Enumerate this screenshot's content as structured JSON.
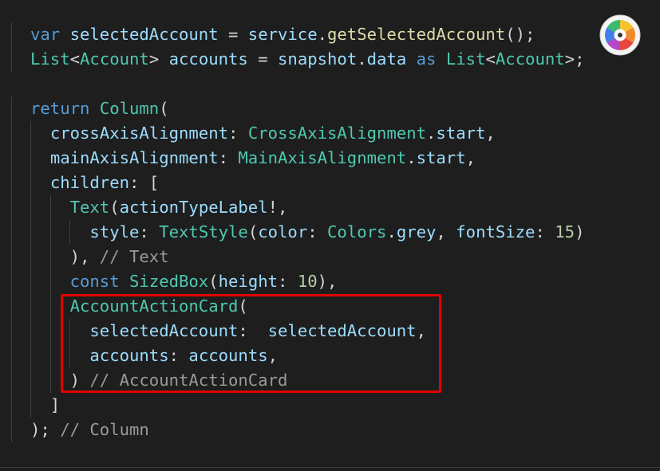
{
  "lines": [
    {
      "tokens": [
        [
          "kw",
          "var"
        ],
        [
          "pl",
          " "
        ],
        [
          "va",
          "selectedAccount"
        ],
        [
          "pl",
          " = "
        ],
        [
          "va",
          "service"
        ],
        [
          "pl",
          "."
        ],
        [
          "fn",
          "getSelectedAccount"
        ],
        [
          "pl",
          "();"
        ]
      ]
    },
    {
      "tokens": [
        [
          "ty",
          "List"
        ],
        [
          "pl",
          "<"
        ],
        [
          "ty",
          "Account"
        ],
        [
          "pl",
          "> "
        ],
        [
          "va",
          "accounts"
        ],
        [
          "pl",
          " = "
        ],
        [
          "va",
          "snapshot"
        ],
        [
          "pl",
          "."
        ],
        [
          "va",
          "data"
        ],
        [
          "pl",
          " "
        ],
        [
          "kw",
          "as"
        ],
        [
          "pl",
          " "
        ],
        [
          "ty",
          "List"
        ],
        [
          "pl",
          "<"
        ],
        [
          "ty",
          "Account"
        ],
        [
          "pl",
          ">;"
        ]
      ]
    },
    {
      "tokens": []
    },
    {
      "tokens": [
        [
          "kw",
          "return"
        ],
        [
          "pl",
          " "
        ],
        [
          "ty",
          "Column"
        ],
        [
          "pl",
          "("
        ]
      ]
    },
    {
      "tokens": [
        [
          "pl",
          "  "
        ],
        [
          "va",
          "crossAxisAlignment"
        ],
        [
          "pl",
          ": "
        ],
        [
          "ty",
          "CrossAxisAlignment"
        ],
        [
          "pl",
          "."
        ],
        [
          "va",
          "start"
        ],
        [
          "pl",
          ","
        ]
      ]
    },
    {
      "tokens": [
        [
          "pl",
          "  "
        ],
        [
          "va",
          "mainAxisAlignment"
        ],
        [
          "pl",
          ": "
        ],
        [
          "ty",
          "MainAxisAlignment"
        ],
        [
          "pl",
          "."
        ],
        [
          "va",
          "start"
        ],
        [
          "pl",
          ","
        ]
      ]
    },
    {
      "tokens": [
        [
          "pl",
          "  "
        ],
        [
          "va",
          "children"
        ],
        [
          "pl",
          ": ["
        ]
      ]
    },
    {
      "tokens": [
        [
          "pl",
          "    "
        ],
        [
          "ty",
          "Text"
        ],
        [
          "pl",
          "("
        ],
        [
          "va",
          "actionTypeLabel"
        ],
        [
          "pl",
          "!,"
        ]
      ]
    },
    {
      "tokens": [
        [
          "pl",
          "      "
        ],
        [
          "va",
          "style"
        ],
        [
          "pl",
          ": "
        ],
        [
          "ty",
          "TextStyle"
        ],
        [
          "pl",
          "("
        ],
        [
          "va",
          "color"
        ],
        [
          "pl",
          ": "
        ],
        [
          "ty",
          "Colors"
        ],
        [
          "pl",
          "."
        ],
        [
          "va",
          "grey"
        ],
        [
          "pl",
          ", "
        ],
        [
          "va",
          "fontSize"
        ],
        [
          "pl",
          ": "
        ],
        [
          "nu",
          "15"
        ],
        [
          "pl",
          ")"
        ]
      ]
    },
    {
      "tokens": [
        [
          "pl",
          "    ), "
        ],
        [
          "cm",
          "// Text"
        ]
      ]
    },
    {
      "tokens": [
        [
          "pl",
          "    "
        ],
        [
          "kw",
          "const"
        ],
        [
          "pl",
          " "
        ],
        [
          "ty",
          "SizedBox"
        ],
        [
          "pl",
          "("
        ],
        [
          "va",
          "height"
        ],
        [
          "pl",
          ": "
        ],
        [
          "nu",
          "10"
        ],
        [
          "pl",
          "),"
        ]
      ]
    },
    {
      "tokens": [
        [
          "pl",
          "    "
        ],
        [
          "ty",
          "AccountActionCard"
        ],
        [
          "pl",
          "("
        ]
      ]
    },
    {
      "tokens": [
        [
          "pl",
          "      "
        ],
        [
          "va",
          "selectedAccount"
        ],
        [
          "pl",
          ":  "
        ],
        [
          "va",
          "selectedAccount"
        ],
        [
          "pl",
          ","
        ]
      ]
    },
    {
      "tokens": [
        [
          "pl",
          "      "
        ],
        [
          "va",
          "accounts"
        ],
        [
          "pl",
          ": "
        ],
        [
          "va",
          "accounts"
        ],
        [
          "pl",
          ","
        ]
      ]
    },
    {
      "tokens": [
        [
          "pl",
          "    ) "
        ],
        [
          "cm",
          "// AccountActionCard"
        ]
      ]
    },
    {
      "tokens": [
        [
          "pl",
          "  ]"
        ]
      ]
    },
    {
      "tokens": [
        [
          "pl",
          "); "
        ],
        [
          "cm",
          "// Column"
        ]
      ]
    }
  ],
  "highlight_color": "#e00000",
  "app_icon": "color-wheel-icon"
}
